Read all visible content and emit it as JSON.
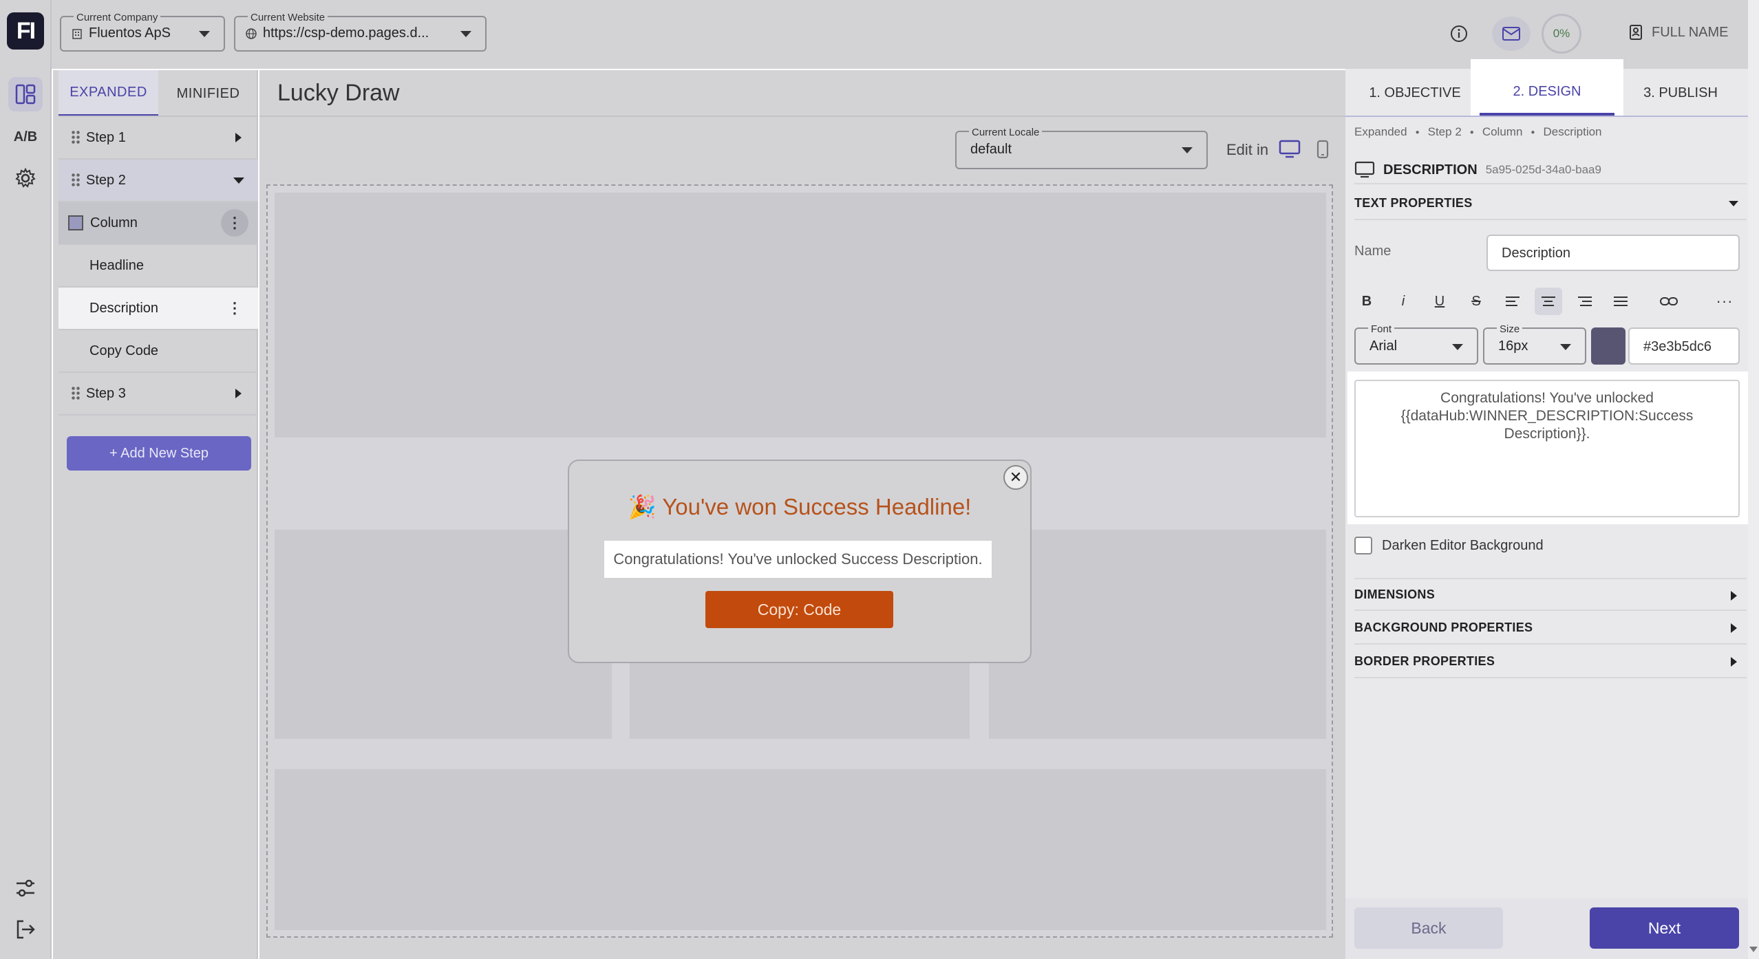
{
  "app": {
    "logo_text": "FI",
    "rail": {
      "ab_label": "A/B"
    }
  },
  "topbar": {
    "company_label": "Current Company",
    "company_value": "Fluentos ApS",
    "website_label": "Current Website",
    "website_value": "https://csp-demo.pages.d...",
    "progress": "0%",
    "user_name": "FULL NAME"
  },
  "left_panel": {
    "tabs": [
      {
        "label": "EXPANDED",
        "active": true
      },
      {
        "label": "MINIFIED",
        "active": false
      }
    ],
    "tree": {
      "step1": "Step 1",
      "step2": "Step 2",
      "column": "Column",
      "headline": "Headline",
      "description": "Description",
      "copy_code": "Copy Code",
      "step3": "Step 3"
    },
    "add_step_label": "+ Add New Step"
  },
  "main": {
    "title": "Lucky Draw",
    "locale_label": "Current Locale",
    "locale_value": "default",
    "edit_in_label": "Edit in",
    "modal": {
      "emoji": "🎉",
      "headline": "You've won Success Headline!",
      "description": "Congratulations! You've unlocked Success Description.",
      "button_label": "Copy: Code",
      "close_glyph": "✕"
    }
  },
  "right_panel": {
    "tabs": [
      {
        "label": "1. OBJECTIVE",
        "active": false
      },
      {
        "label": "2. DESIGN",
        "active": true
      },
      {
        "label": "3. PUBLISH",
        "active": false
      }
    ],
    "breadcrumb": [
      "Expanded",
      "Step 2",
      "Column",
      "Description"
    ],
    "element_type": "DESCRIPTION",
    "element_id": "5a95-025d-34a0-baa9",
    "text_properties_title": "TEXT PROPERTIES",
    "name_label": "Name",
    "name_value": "Description",
    "toolbar": {
      "bold": "B",
      "italic": "i",
      "underline": "U",
      "strike": "S",
      "more": "···"
    },
    "font_label": "Font",
    "font_value": "Arial",
    "size_label": "Size",
    "size_value": "16px",
    "color_value": "#3e3b5dc6",
    "text_content": "Congratulations! You've unlocked {{dataHub:WINNER_DESCRIPTION:Success Description}}.",
    "darken_label": "Darken Editor Background",
    "sections": [
      "DIMENSIONS",
      "BACKGROUND PROPERTIES",
      "BORDER PROPERTIES"
    ],
    "back_label": "Back",
    "next_label": "Next"
  },
  "colors": {
    "accent": "#4a43a8",
    "cta": "#c14a0c",
    "headline": "#b7521a",
    "swatch": "#3e3b5d"
  }
}
